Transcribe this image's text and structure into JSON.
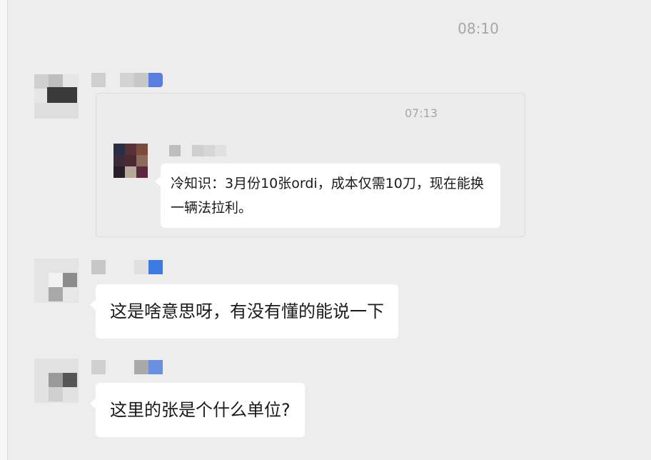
{
  "chat": {
    "time_divider": "08:10",
    "quoted": {
      "time": "07:13",
      "text": "冷知识：3月份10张ordi，成本仅需10刀，现在能换一辆法拉利。"
    },
    "messages": [
      {
        "text": "这是啥意思呀，有没有懂的能说一下"
      },
      {
        "text": "这里的张是个什么单位?"
      }
    ]
  }
}
